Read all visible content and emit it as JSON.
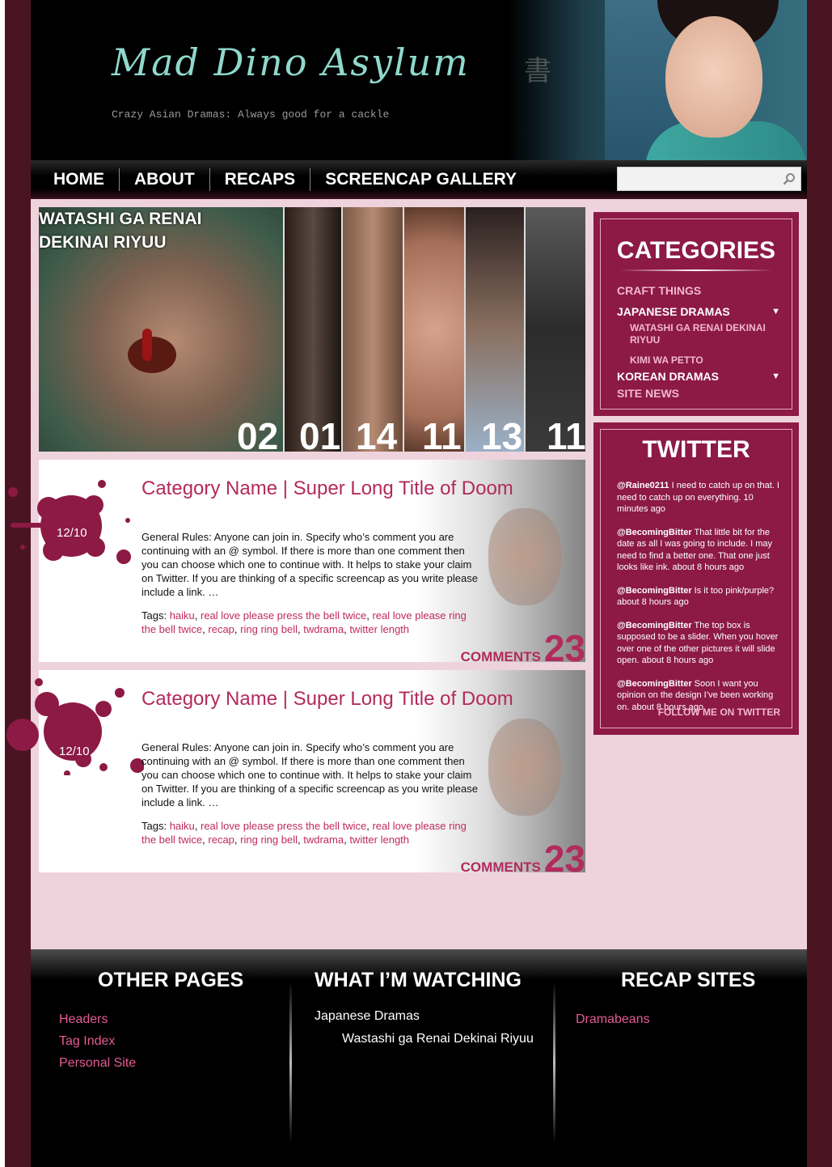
{
  "header": {
    "logo": "Mad Dino Asylum",
    "tagline": "Crazy Asian Dramas: Always good for a cackle"
  },
  "nav": {
    "items": [
      "HOME",
      "ABOUT",
      "RECAPS",
      "SCREENCAP GALLERY"
    ],
    "search_placeholder": "",
    "search_icon": "magnifier-icon"
  },
  "slider": {
    "title": "WATASHI GA RENAI DEKINAI RIYUU",
    "numbers": [
      "02",
      "01",
      "14",
      "11",
      "13",
      "11"
    ]
  },
  "posts": [
    {
      "date": "12/10",
      "title": "Category Name | Super Long Title of Doom",
      "body": "General Rules: Anyone can join in. Specify who’s comment you are continuing with an @ symbol. If there is more than one comment then you can choose which one to continue with. It helps to stake your claim on Twitter. If you are thinking of a specific screencap as you write please include a link. …",
      "tags_label": "Tags: ",
      "tags": [
        "haiku",
        "real love please press the bell twice",
        "real love please ring the bell twice",
        "recap",
        "ring ring bell",
        "twdrama",
        "twitter length"
      ],
      "comments_label": "COMMENTS",
      "comments_count": "23"
    },
    {
      "date": "12/10",
      "title": "Category Name | Super Long Title of Doom",
      "body": "General Rules: Anyone can join in. Specify who’s comment you are continuing with an @ symbol. If there is more than one comment then you can choose which one to continue with. It helps to stake your claim on Twitter. If you are thinking of a specific screencap as you write please include a link. …",
      "tags_label": "Tags: ",
      "tags": [
        "haiku",
        "real love please press the bell twice",
        "real love please ring the bell twice",
        "recap",
        "ring ring bell",
        "twdrama",
        "twitter length"
      ],
      "comments_label": "COMMENTS",
      "comments_count": "23"
    }
  ],
  "sidebar": {
    "categories_title": "CATEGORIES",
    "categories": {
      "craft": "CRAFT THINGS",
      "japanese": "JAPANESE DRAMAS",
      "japanese_sub1": "WATASHI GA RENAI DEKINAI RIYUU",
      "japanese_sub2": "KIMI WA PETTO",
      "korean": "KOREAN DRAMAS",
      "news": "SITE NEWS"
    },
    "twitter_title": "TWITTER",
    "tweets": [
      {
        "user": "@Raine0211",
        "text": " I need to catch up on that. I need to catch up on everything. 10 minutes ago"
      },
      {
        "user": "@BecomingBitter",
        "text": " That little bit for the date as all I was going to include. I may need to find a better one. That one just looks like ink. about 8 hours ago"
      },
      {
        "user": "@BecomingBitter",
        "text": " Is it too pink/purple? about 8 hours ago"
      },
      {
        "user": "@BecomingBitter",
        "text": " The top box is supposed to be a slider. When you hover over one of the other pictures it will slide open. about 8 hours ago"
      },
      {
        "user": "@BecomingBitter",
        "text": " Soon I want you opinion on the design I’ve been working on. about 8 hours ago"
      }
    ],
    "follow": "FOLLOW ME ON TWITTER"
  },
  "footer": {
    "other_pages_title": "OTHER PAGES",
    "other_pages": [
      "Headers",
      "Tag Index",
      "Personal Site"
    ],
    "watching_title": "WHAT I’M WATCHING",
    "watching_category": "Japanese Dramas",
    "watching_item": "Wastashi ga Renai Dekinai Riyuu",
    "recap_title": "RECAP SITES",
    "recap_sites": [
      "Dramabeans"
    ]
  },
  "colors": {
    "accent": "#8c1a44",
    "link": "#e65b92",
    "content_bg": "#efd3dc",
    "logo": "#8fd9cc"
  }
}
